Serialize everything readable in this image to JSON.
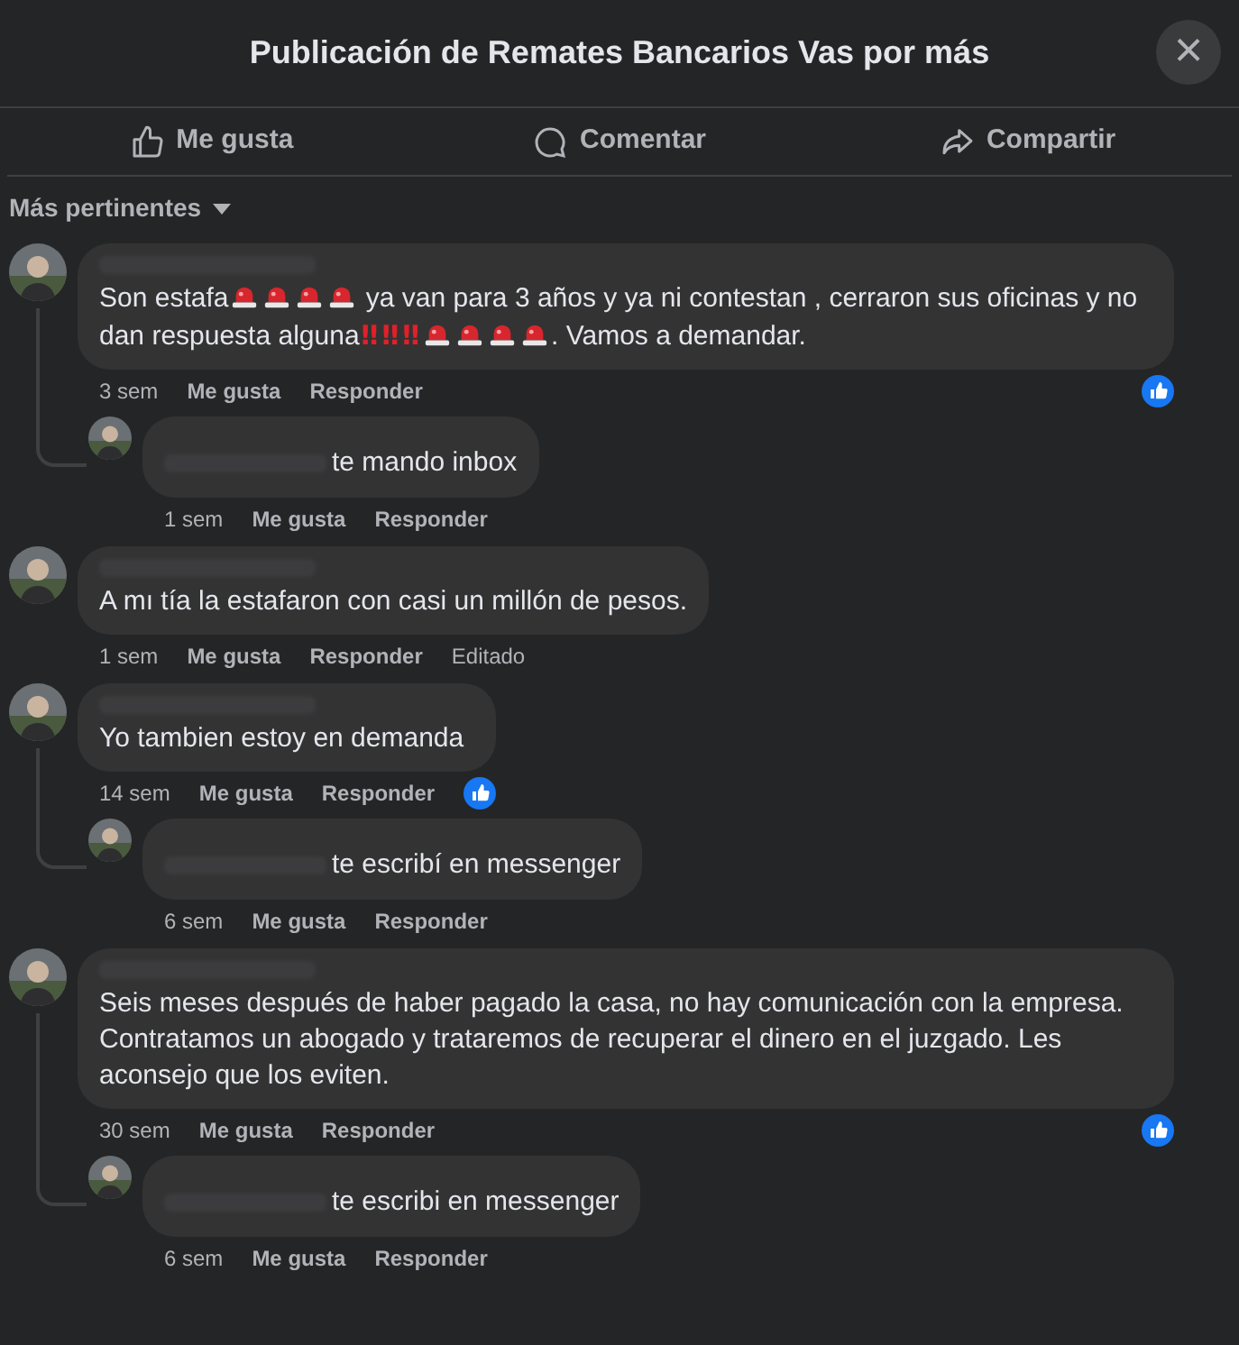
{
  "header": {
    "title": "Publicación de Remates Bancarios Vas por más",
    "close": "×"
  },
  "actions": [
    {
      "kind": "like",
      "label": "Me gusta"
    },
    {
      "kind": "comment",
      "label": "Comentar"
    },
    {
      "kind": "share",
      "label": "Compartir"
    }
  ],
  "sort": {
    "label": "Más pertinentes"
  },
  "comments": [
    {
      "segments": [
        {
          "kind": "text",
          "text": "Son estafa"
        },
        {
          "kind": "siren"
        },
        {
          "kind": "siren"
        },
        {
          "kind": "siren"
        },
        {
          "kind": "siren"
        },
        {
          "kind": "text",
          "text": " ya van para 3 años y ya ni contestan , cerraron sus oficinas y no dan respuesta alguna"
        },
        {
          "kind": "bangbang",
          "text": "‼"
        },
        {
          "kind": "bangbang",
          "text": "‼"
        },
        {
          "kind": "bangbang",
          "text": "‼"
        },
        {
          "kind": "siren"
        },
        {
          "kind": "siren"
        },
        {
          "kind": "siren"
        },
        {
          "kind": "siren"
        },
        {
          "kind": "text",
          "text": ". Vamos a demandar."
        }
      ],
      "time": "3 sem",
      "like": "Me gusta",
      "reply": "Responder",
      "reacted": true,
      "replies": [
        {
          "text": "te mando inbox",
          "time": "1 sem",
          "like": "Me gusta",
          "reply": "Responder"
        }
      ]
    },
    {
      "segments": [
        {
          "kind": "text",
          "text": "A mı tía la estafaron con casi un millón de pesos."
        }
      ],
      "time": "1 sem",
      "like": "Me gusta",
      "reply": "Responder",
      "edited": "Editado",
      "reacted": false
    },
    {
      "segments": [
        {
          "kind": "text",
          "text": "Yo tambien estoy en demanda"
        }
      ],
      "time": "14 sem",
      "like": "Me gusta",
      "reply": "Responder",
      "reacted": true,
      "replies": [
        {
          "text": "te escribí en messenger",
          "time": "6 sem",
          "like": "Me gusta",
          "reply": "Responder"
        }
      ]
    },
    {
      "segments": [
        {
          "kind": "text",
          "text": "Seis meses después de haber pagado la casa, no hay comunicación con la empresa. Contratamos un abogado y trataremos de recuperar el dinero en el juzgado. Les aconsejo que los eviten."
        }
      ],
      "time": "30 sem",
      "like": "Me gusta",
      "reply": "Responder",
      "reacted": true,
      "replies": [
        {
          "text": "te escribi en messenger",
          "time": "6 sem",
          "like": "Me gusta",
          "reply": "Responder"
        }
      ]
    }
  ]
}
